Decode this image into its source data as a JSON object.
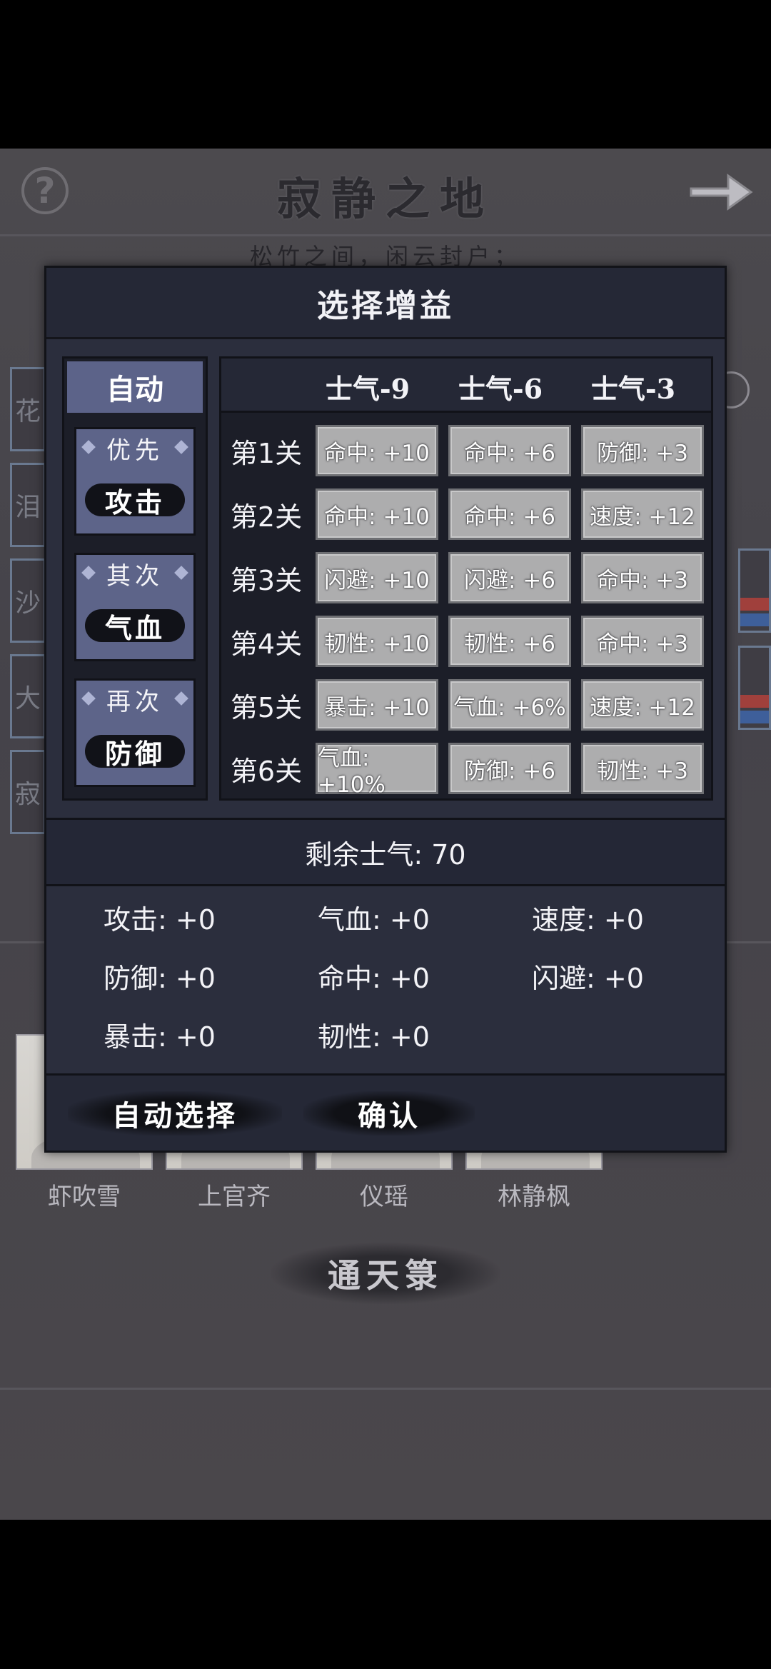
{
  "background": {
    "title": "寂静之地",
    "subtitle": "松竹之间，闲云封户；",
    "side_tabs": [
      "花",
      "泪",
      "沙",
      "大",
      "寂"
    ],
    "heroes": [
      {
        "name": "虾吹雪"
      },
      {
        "name": "上官齐"
      },
      {
        "name": "仪瑶"
      },
      {
        "name": "林静枫"
      }
    ],
    "bottom_button": "通天箓"
  },
  "dialog": {
    "title": "选择增益",
    "auto_label": "自动",
    "priorities": [
      {
        "label": "优先",
        "value": "攻击"
      },
      {
        "label": "其次",
        "value": "气血"
      },
      {
        "label": "再次",
        "value": "防御"
      }
    ],
    "columns": [
      "士气-9",
      "士气-6",
      "士气-3"
    ],
    "rows": [
      {
        "label": "第1关",
        "cells": [
          "命中: +10",
          "命中: +6",
          "防御: +3"
        ]
      },
      {
        "label": "第2关",
        "cells": [
          "命中: +10",
          "命中: +6",
          "速度: +12"
        ]
      },
      {
        "label": "第3关",
        "cells": [
          "闪避: +10",
          "闪避: +6",
          "命中: +3"
        ]
      },
      {
        "label": "第4关",
        "cells": [
          "韧性: +10",
          "韧性: +6",
          "命中: +3"
        ]
      },
      {
        "label": "第5关",
        "cells": [
          "暴击: +10",
          "气血: +6%",
          "速度: +12"
        ]
      },
      {
        "label": "第6关",
        "cells": [
          "气血: +10%",
          "防御: +6",
          "韧性: +3"
        ]
      }
    ],
    "remaining_morale": "剩余士气: 70",
    "stats": [
      "攻击: +0",
      "气血: +0",
      "速度: +0",
      "防御: +0",
      "命中: +0",
      "闪避: +0",
      "暴击: +0",
      "韧性: +0"
    ],
    "auto_select_button": "自动选择",
    "confirm_button": "确认"
  }
}
